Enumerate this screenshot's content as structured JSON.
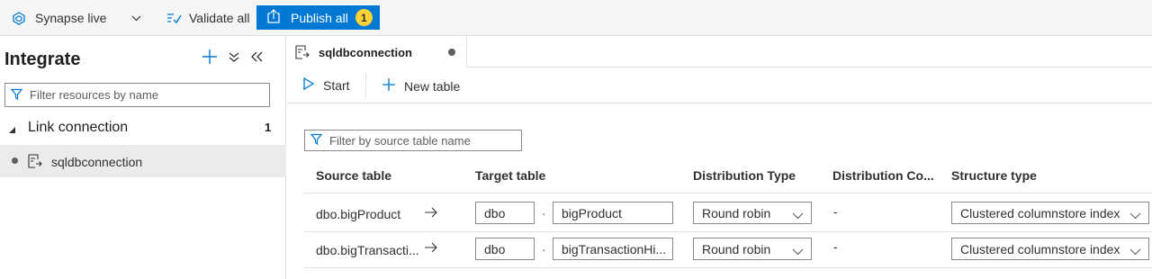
{
  "toolbar": {
    "workspace_label": "Synapse live",
    "validate_label": "Validate all",
    "publish_label": "Publish all",
    "publish_count": "1"
  },
  "sidebar": {
    "title": "Integrate",
    "filter_placeholder": "Filter resources by name",
    "group": {
      "label": "Link connection",
      "count": "1"
    },
    "items": [
      {
        "label": "sqldbconnection"
      }
    ]
  },
  "tab": {
    "label": "sqldbconnection"
  },
  "actions": {
    "start_label": "Start",
    "new_table_label": "New table"
  },
  "table": {
    "filter_placeholder": "Filter by source table name",
    "headers": {
      "source": "Source table",
      "target": "Target table",
      "distribution_type": "Distribution Type",
      "distribution_column": "Distribution Co...",
      "structure_type": "Structure type"
    },
    "rows": [
      {
        "source": "dbo.bigProduct",
        "target_schema": "dbo",
        "separator": "·",
        "target_table": "bigProduct",
        "distribution_type": "Round robin",
        "distribution_column": "-",
        "structure_type": "Clustered columnstore index"
      },
      {
        "source": "dbo.bigTransacti...",
        "target_schema": "dbo",
        "separator": "·",
        "target_table": "bigTransactionHi...",
        "distribution_type": "Round robin",
        "distribution_column": "-",
        "structure_type": "Clustered columnstore index"
      }
    ]
  },
  "colors": {
    "accent": "#0078d4",
    "badge": "#ffd335",
    "selected_bg": "#edebe9"
  }
}
